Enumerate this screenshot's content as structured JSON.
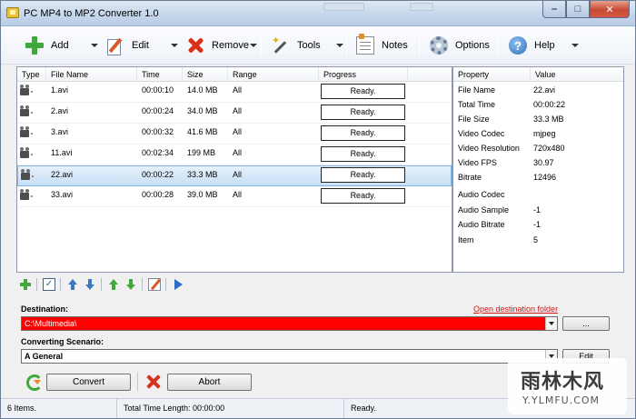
{
  "window": {
    "title": "PC MP4 to MP2 Converter 1.0"
  },
  "toolbar": {
    "add": "Add",
    "edit": "Edit",
    "remove": "Remove",
    "tools": "Tools",
    "notes": "Notes",
    "options": "Options",
    "help": "Help"
  },
  "file_list": {
    "columns": [
      "Type",
      "File Name",
      "Time",
      "Size",
      "Range",
      "Progress"
    ],
    "rows": [
      {
        "name": "1.avi",
        "time": "00:00:10",
        "size": "14.0 MB",
        "range": "All",
        "progress": "Ready.",
        "selected": false
      },
      {
        "name": "2.avi",
        "time": "00:00:24",
        "size": "34.0 MB",
        "range": "All",
        "progress": "Ready.",
        "selected": false
      },
      {
        "name": "3.avi",
        "time": "00:00:32",
        "size": "41.6 MB",
        "range": "All",
        "progress": "Ready.",
        "selected": false
      },
      {
        "name": "11.avi",
        "time": "00:02:34",
        "size": "199 MB",
        "range": "All",
        "progress": "Ready.",
        "selected": false
      },
      {
        "name": "22.avi",
        "time": "00:00:22",
        "size": "33.3 MB",
        "range": "All",
        "progress": "Ready.",
        "selected": true
      },
      {
        "name": "33.avi",
        "time": "00:00:28",
        "size": "39.0 MB",
        "range": "All",
        "progress": "Ready.",
        "selected": false
      }
    ]
  },
  "properties": {
    "header_property": "Property",
    "header_value": "Value",
    "rows": [
      {
        "key": "File Name",
        "value": "22.avi"
      },
      {
        "key": "Total Time",
        "value": "00:00:22"
      },
      {
        "key": "File Size",
        "value": "33.3 MB"
      },
      {
        "key": "Video Codec",
        "value": "mjpeg"
      },
      {
        "key": "Video Resolution",
        "value": "720x480"
      },
      {
        "key": "Video FPS",
        "value": "30.97"
      },
      {
        "key": "Bitrate",
        "value": "12496"
      },
      {
        "key": "Audio Codec",
        "value": ""
      },
      {
        "key": "Audio Sample",
        "value": "-1"
      },
      {
        "key": "Audio Bitrate",
        "value": "-1"
      },
      {
        "key": "Item",
        "value": "5"
      }
    ]
  },
  "destination": {
    "label": "Destination:",
    "value": "C:\\Multimedia\\",
    "open_link": "Open destination folder",
    "browse_label": "...",
    "highlight_color": "#ff0000"
  },
  "scenario": {
    "label": "Converting Scenario:",
    "value": "A General",
    "edit_label": "Edit"
  },
  "actions": {
    "convert": "Convert",
    "abort": "Abort"
  },
  "status": {
    "items": "6 Items.",
    "total_time": "Total Time Length: 00:00:00",
    "state": "Ready."
  },
  "watermark": {
    "main": "雨林木风",
    "url": "Y.YLMFU.COM"
  }
}
